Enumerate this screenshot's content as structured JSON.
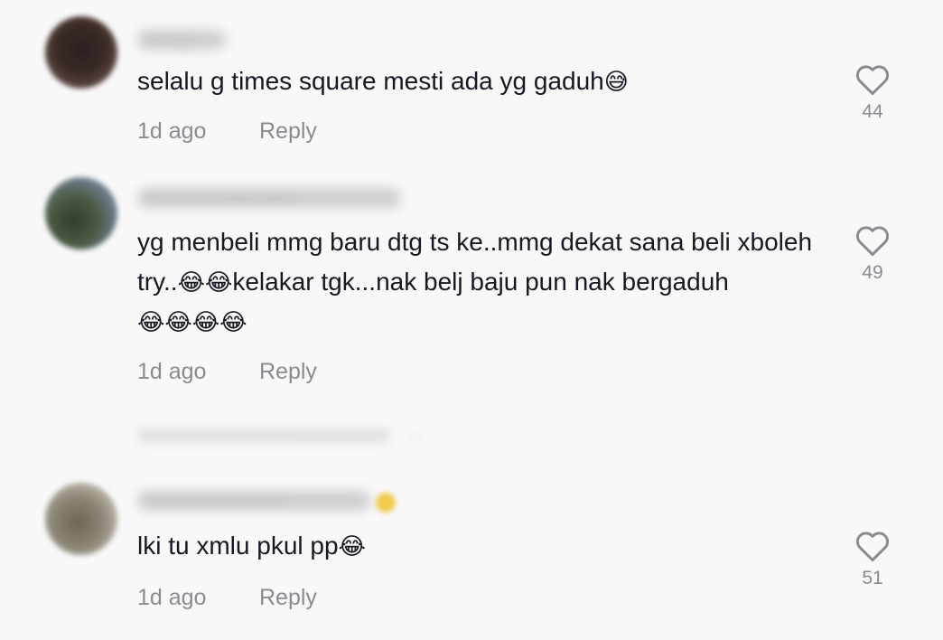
{
  "comments": [
    {
      "username": "bongy",
      "text": "selalu g times square mesti ada yg gaduh",
      "text_emoji": "😅",
      "time": "1d ago",
      "reply_label": "Reply",
      "likes": "44"
    },
    {
      "username": "imamnuraliahalini",
      "text_part1": "yg menbeli mmg baru dtg ts ke..mmg dekat sana beli xboleh try..",
      "text_emoji1": "😂😂",
      "text_part2": "kelakar tgk...nak belj baju pun nak bergaduh",
      "text_emoji2": "😂😂😂😂",
      "time": "1d ago",
      "reply_label": "Reply",
      "likes": "49"
    },
    {
      "username": "f.azniwazirizwan",
      "text": "lki tu xmlu pkul pp",
      "text_emoji": "😂",
      "time": "1d ago",
      "reply_label": "Reply",
      "likes": "51"
    }
  ],
  "view_replies": {
    "label": "View more replies (26)",
    "arrow": "⌄"
  },
  "icons": {
    "like": "heart-outline-icon"
  },
  "colors": {
    "background": "#f8f8f8",
    "text": "#161823",
    "muted": "#8a8b91"
  }
}
